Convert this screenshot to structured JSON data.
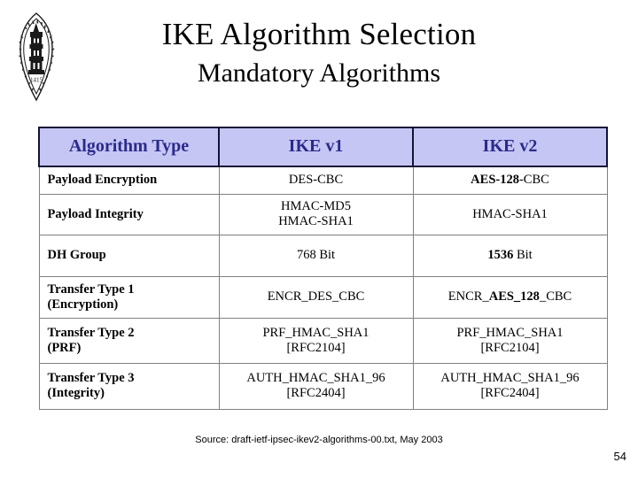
{
  "logo": {
    "name": "university-seal",
    "year": "1415",
    "ring_text": "SIGILLUM UNIVERSITATIS STUDII SANCTI ANDREE"
  },
  "header": {
    "title": "IKE Algorithm Selection",
    "subtitle": "Mandatory Algorithms"
  },
  "table": {
    "columns": [
      "Algorithm Type",
      "IKE v1",
      "IKE v2"
    ],
    "rows": [
      {
        "type": "Payload Encryption",
        "ikev1": [
          {
            "text": "DES-CBC",
            "bold": false
          }
        ],
        "ikev2": [
          {
            "text": "AES-128",
            "bold": true
          },
          {
            "text": "-CBC",
            "bold": false
          }
        ]
      },
      {
        "type": "Payload Integrity",
        "ikev1": [
          {
            "text": "HMAC-MD5",
            "bold": false,
            "br": true
          },
          {
            "text": "HMAC-SHA1",
            "bold": false
          }
        ],
        "ikev2": [
          {
            "text": "HMAC-SHA1",
            "bold": false
          }
        ]
      },
      {
        "type": "DH Group",
        "ikev1": [
          {
            "text": "768 Bit",
            "bold": false
          }
        ],
        "ikev2": [
          {
            "text": "1536",
            "bold": true
          },
          {
            "text": " Bit",
            "bold": false
          }
        ]
      },
      {
        "type": "Transfer Type 1\n(Encryption)",
        "ikev1": [
          {
            "text": "ENCR_DES_CBC",
            "bold": false
          }
        ],
        "ikev2": [
          {
            "text": "ENCR_",
            "bold": false
          },
          {
            "text": "AES_128",
            "bold": true
          },
          {
            "text": "_CBC",
            "bold": false
          }
        ]
      },
      {
        "type": "Transfer Type 2\n(PRF)",
        "ikev1": [
          {
            "text": "PRF_HMAC_SHA1",
            "bold": false,
            "br": true
          },
          {
            "text": "[RFC2104]",
            "bold": false
          }
        ],
        "ikev2": [
          {
            "text": "PRF_HMAC_SHA1",
            "bold": false,
            "br": true
          },
          {
            "text": "[RFC2104]",
            "bold": false
          }
        ]
      },
      {
        "type": "Transfer Type 3\n(Integrity)",
        "ikev1": [
          {
            "text": "AUTH_HMAC_SHA1_96",
            "bold": false,
            "br": true
          },
          {
            "text": "[RFC2404]",
            "bold": false
          }
        ],
        "ikev2": [
          {
            "text": "AUTH_HMAC_SHA1_96",
            "bold": false,
            "br": true
          },
          {
            "text": "[RFC2404]",
            "bold": false
          }
        ]
      }
    ]
  },
  "footer": {
    "source": "Source: draft-ietf-ipsec-ikev2-algorithms-00.txt, May 2003",
    "page_number": "54"
  },
  "colors": {
    "header_bg": "#c6c6f5",
    "header_text": "#2a2a8c",
    "header_border": "#141436",
    "body_border": "#808080",
    "page_bg": "#ffffff",
    "body_text": "#000000"
  }
}
